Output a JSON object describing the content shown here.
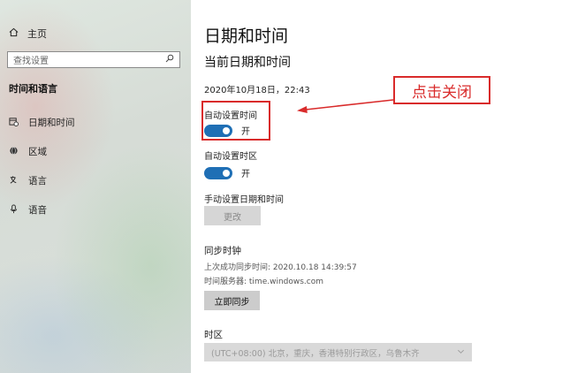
{
  "sidebar": {
    "home_label": "主页",
    "search_placeholder": "查找设置",
    "section_title": "时间和语言",
    "items": [
      {
        "label": "日期和时间",
        "icon": "clock-calendar-icon"
      },
      {
        "label": "区域",
        "icon": "globe-icon"
      },
      {
        "label": "语言",
        "icon": "language-icon"
      },
      {
        "label": "语音",
        "icon": "microphone-icon"
      }
    ]
  },
  "main": {
    "page_title": "日期和时间",
    "section_current": "当前日期和时间",
    "current_datetime": "2020年10月18日，22:43",
    "auto_time": {
      "label": "自动设置时间",
      "state_label": "开"
    },
    "auto_timezone": {
      "label": "自动设置时区",
      "state_label": "开"
    },
    "manual": {
      "label": "手动设置日期和时间",
      "button_label": "更改"
    },
    "sync": {
      "title": "同步时钟",
      "last_sync": "上次成功同步时间: 2020.10.18 14:39:57",
      "time_server": "时间服务器: time.windows.com",
      "button_label": "立即同步"
    },
    "timezone": {
      "title": "时区",
      "selected": "(UTC+08:00) 北京，重庆，香港特别行政区，乌鲁木齐"
    }
  },
  "annotation": {
    "callout_text": "点击关闭",
    "color": "#d92b2b"
  },
  "colors": {
    "toggle_on": "#1f6fb5"
  }
}
